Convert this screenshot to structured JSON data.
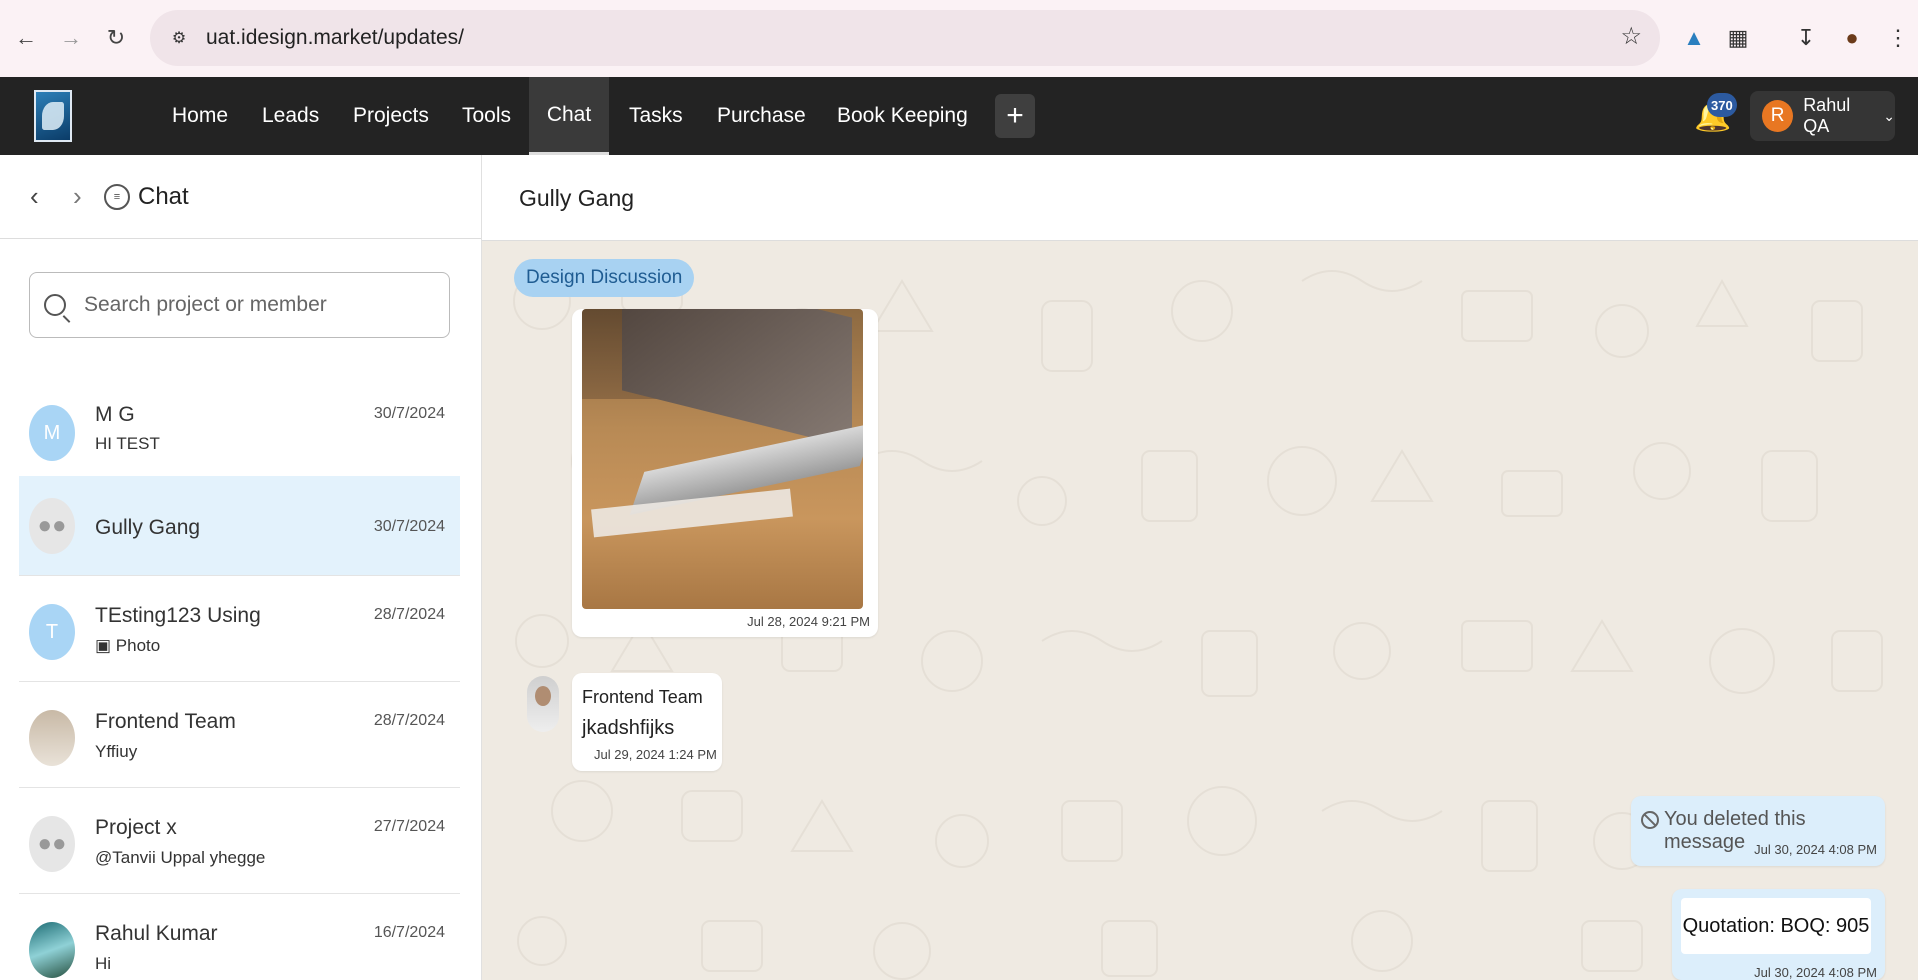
{
  "browser": {
    "url": "uat.idesign.market/updates/"
  },
  "nav": {
    "items": [
      "Home",
      "Leads",
      "Projects",
      "Tools",
      "Chat",
      "Tasks",
      "Purchase",
      "Book Keeping"
    ],
    "active": "Chat",
    "notifications_count": "370",
    "user_initial": "R",
    "user_name": "Rahul QA"
  },
  "sidebar": {
    "title": "Chat",
    "search_placeholder": "Search project or member",
    "conversations": [
      {
        "name": "M G",
        "preview": "HI TEST",
        "date": "30/7/2024",
        "avatar": "M",
        "avatar_type": "letter"
      },
      {
        "name": "Gully Gang",
        "preview": "",
        "date": "30/7/2024",
        "avatar": "group-icon",
        "avatar_type": "group",
        "active": true
      },
      {
        "name": "TEsting123 Using",
        "preview": "Photo",
        "date": "28/7/2024",
        "avatar": "T",
        "avatar_type": "letter"
      },
      {
        "name": "Frontend Team",
        "preview": "Yffiuy",
        "date": "28/7/2024",
        "avatar": "photo",
        "avatar_type": "photo"
      },
      {
        "name": "Project x",
        "preview": "@Tanvii Uppal yhegge",
        "date": "27/7/2024",
        "avatar": "group-icon",
        "avatar_type": "group"
      },
      {
        "name": "Rahul Kumar",
        "preview": "Hi",
        "date": "16/7/2024",
        "avatar": "photo",
        "avatar_type": "photo"
      }
    ]
  },
  "chat": {
    "title": "Gully Gang",
    "tag": "Design Discussion",
    "messages": {
      "image": {
        "timestamp": "Jul 28, 2024 9:21 PM"
      },
      "text": {
        "sender": "Frontend Team",
        "body": "jkadshfijks",
        "timestamp": "Jul 29, 2024 1:24 PM"
      },
      "deleted": {
        "body": "You deleted this message",
        "timestamp": "Jul 30, 2024 4:08 PM"
      },
      "quotation": {
        "body": "Quotation: BOQ: 905",
        "timestamp": "Jul 30, 2024 4:08 PM"
      }
    }
  }
}
